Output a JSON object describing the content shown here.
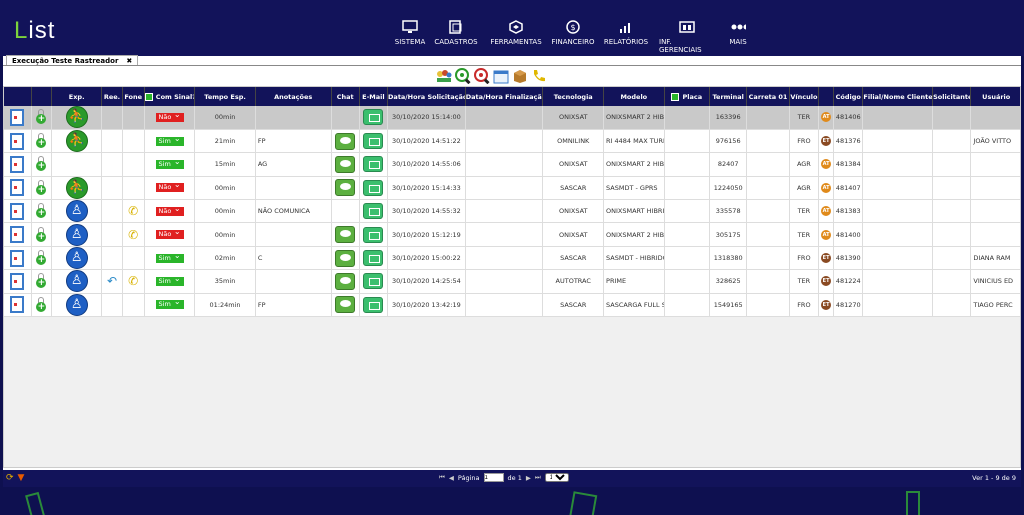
{
  "app": {
    "logo": "List"
  },
  "nav": [
    {
      "label": "SISTEMA",
      "icon": "monitor-icon"
    },
    {
      "label": "CADASTROS",
      "icon": "register-icon"
    },
    {
      "label": "FERRAMENTAS",
      "icon": "tools-icon"
    },
    {
      "label": "FINANCEIRO",
      "icon": "money-icon"
    },
    {
      "label": "RELATÓRIOS",
      "icon": "chart-icon"
    },
    {
      "label": "INF. GERENCIAIS",
      "icon": "management-icon"
    },
    {
      "label": "MAIS",
      "icon": "more-icon"
    }
  ],
  "panel": {
    "title": "Execução Teste Rastreador",
    "close": "✖"
  },
  "toolbar": [
    "people-icon",
    "zoom-in-icon",
    "zoom-out-icon",
    "calendar-icon",
    "box-icon",
    "phone-icon"
  ],
  "columns": [
    "",
    "",
    "Exp.",
    "Ree.",
    "Fone",
    "Com Sinal?",
    "Tempo Esp.",
    "Anotações",
    "Chat",
    "E-Mail",
    "Data/Hora Solicitação",
    "Data/Hora Finalização",
    "Tecnologia",
    "Modelo",
    "Placa",
    "Terminal",
    "Carreta 01",
    "Vínculo",
    "",
    "Código",
    "Filial/Nome Cliente",
    "Solicitante",
    "Usuário"
  ],
  "rows": [
    {
      "exp": "green",
      "ree": "",
      "fone": "",
      "sinal": "Não",
      "tempo": "00min",
      "anot": "",
      "chat": false,
      "data_sol": "30/10/2020 15:14:00",
      "tec": "ONIXSAT",
      "modelo": "ONIXSMART 2 HIBR",
      "terminal": "163396",
      "vinculo": "TER",
      "badge": "AT",
      "codigo": "481406",
      "usuario": "",
      "selected": true
    },
    {
      "exp": "green",
      "ree": "",
      "fone": "",
      "sinal": "Sim",
      "tempo": "21min",
      "anot": "FP",
      "chat": true,
      "data_sol": "30/10/2020 14:51:22",
      "tec": "OMNILINK",
      "modelo": "RI 4484 MAX TURBI",
      "terminal": "976156",
      "vinculo": "FRO",
      "badge": "ET",
      "codigo": "481376",
      "usuario": "JOÃO VITTO",
      "selected": false
    },
    {
      "exp": "",
      "ree": "",
      "fone": "",
      "sinal": "Sim",
      "tempo": "15min",
      "anot": "AG",
      "chat": true,
      "data_sol": "30/10/2020 14:55:06",
      "tec": "ONIXSAT",
      "modelo": "ONIXSMART 2 HIBR",
      "terminal": "82407",
      "vinculo": "AGR",
      "badge": "AT",
      "codigo": "481384",
      "usuario": "",
      "selected": false
    },
    {
      "exp": "green",
      "ree": "",
      "fone": "",
      "sinal": "Não",
      "tempo": "00min",
      "anot": "",
      "chat": true,
      "data_sol": "30/10/2020 15:14:33",
      "tec": "SASCAR",
      "modelo": "SASMDT - GPRS",
      "terminal": "1224050",
      "vinculo": "AGR",
      "badge": "AT",
      "codigo": "481407",
      "usuario": "",
      "selected": false
    },
    {
      "exp": "blue",
      "ree": "",
      "fone": "yes",
      "sinal": "Não",
      "tempo": "00min",
      "anot": "NÃO COMUNICA",
      "chat": false,
      "data_sol": "30/10/2020 14:55:32",
      "tec": "ONIXSAT",
      "modelo": "ONIXSMART HIBRID",
      "terminal": "335578",
      "vinculo": "TER",
      "badge": "AT",
      "codigo": "481383",
      "usuario": "",
      "selected": false
    },
    {
      "exp": "blue",
      "ree": "",
      "fone": "yes",
      "sinal": "Não",
      "tempo": "00min",
      "anot": "",
      "chat": true,
      "data_sol": "30/10/2020 15:12:19",
      "tec": "ONIXSAT",
      "modelo": "ONIXSMART 2 HIBR",
      "terminal": "305175",
      "vinculo": "TER",
      "badge": "AT",
      "codigo": "481400",
      "usuario": "",
      "selected": false
    },
    {
      "exp": "blue",
      "ree": "",
      "fone": "",
      "sinal": "Sim",
      "tempo": "02min",
      "anot": "C",
      "chat": true,
      "data_sol": "30/10/2020 15:00:22",
      "tec": "SASCAR",
      "modelo": "SASMDT - HIBRIDO",
      "terminal": "1318380",
      "vinculo": "FRO",
      "badge": "ET",
      "codigo": "481390",
      "usuario": "DIANA RAM",
      "selected": false
    },
    {
      "exp": "blue",
      "ree": "yes",
      "fone": "yes",
      "sinal": "Sim",
      "tempo": "35min",
      "anot": "",
      "chat": true,
      "data_sol": "30/10/2020 14:25:54",
      "tec": "AUTOTRAC",
      "modelo": "PRIME",
      "terminal": "328625",
      "vinculo": "TER",
      "badge": "ET",
      "codigo": "481224",
      "usuario": "VINICIUS ED",
      "selected": false
    },
    {
      "exp": "blue",
      "ree": "",
      "fone": "",
      "sinal": "Sim",
      "tempo": "01:24min",
      "anot": "FP",
      "chat": true,
      "data_sol": "30/10/2020 13:42:19",
      "tec": "SASCAR",
      "modelo": "SASCARGA FULL SA",
      "terminal": "1549165",
      "vinculo": "FRO",
      "badge": "ET",
      "codigo": "481270",
      "usuario": "TIAGO PERC",
      "selected": false
    }
  ],
  "footer": {
    "page_label": "Página",
    "page_value": "1",
    "of_label": "de 1",
    "page_size": "120",
    "records": "Ver 1 - 9 de 9"
  }
}
